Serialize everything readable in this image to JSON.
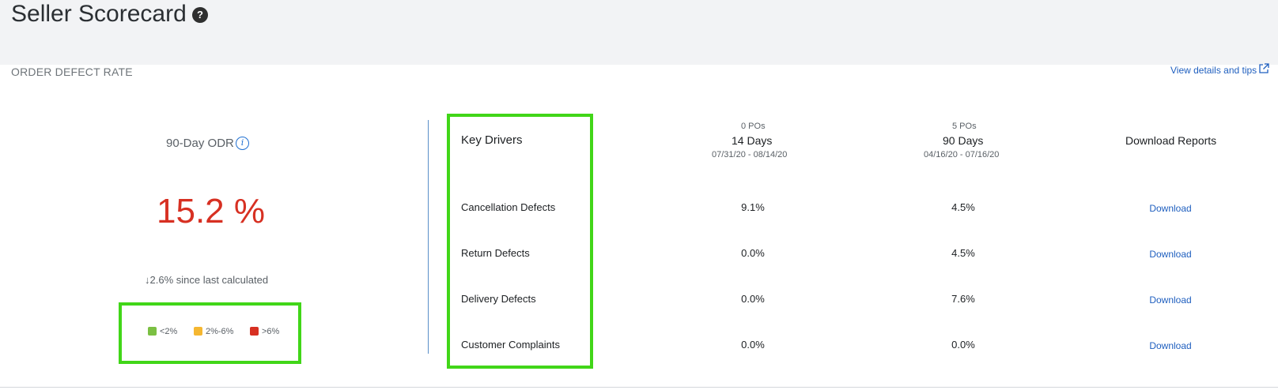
{
  "header": {
    "title": "Seller Scorecard",
    "help_icon": "question-circle-icon"
  },
  "section": {
    "title": "ORDER DEFECT RATE",
    "view_link": "View details and tips",
    "external_icon": "external-link-icon"
  },
  "odr": {
    "label": "90-Day ODR",
    "info_icon": "info-icon",
    "value": "15.2 %",
    "change": "2.6% since last calculated",
    "change_arrow": "↓"
  },
  "legend": [
    {
      "label": "<2%",
      "color": "#7bc043"
    },
    {
      "label": "2%-6%",
      "color": "#f5b731"
    },
    {
      "label": ">6%",
      "color": "#d73022"
    }
  ],
  "table": {
    "key_drivers_label": "Key Drivers",
    "columns": [
      {
        "pos": "0 POs",
        "period": "14 Days",
        "range": "07/31/20 - 08/14/20"
      },
      {
        "pos": "5 POs",
        "period": "90 Days",
        "range": "04/16/20 - 07/16/20"
      }
    ],
    "download_reports_label": "Download Reports",
    "rows": [
      {
        "label": "Cancellation Defects",
        "d14": "9.1%",
        "d90": "4.5%",
        "action": "Download"
      },
      {
        "label": "Return Defects",
        "d14": "0.0%",
        "d90": "4.5%",
        "action": "Download"
      },
      {
        "label": "Delivery Defects",
        "d14": "0.0%",
        "d90": "7.6%",
        "action": "Download"
      },
      {
        "label": "Customer Complaints",
        "d14": "0.0%",
        "d90": "0.0%",
        "action": "Download"
      }
    ]
  },
  "colors": {
    "highlight": "#41d618",
    "link": "#1f5fbf",
    "danger": "#d73022"
  }
}
